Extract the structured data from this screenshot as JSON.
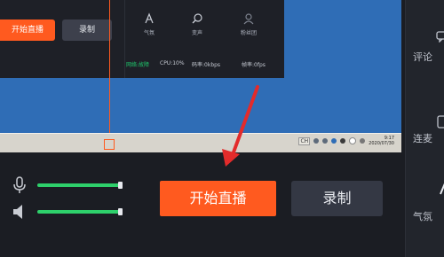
{
  "preview": {
    "mini_panel": {
      "start_label": "开始直播",
      "record_label": "录制",
      "tools": [
        {
          "label": "气氛",
          "icon": "ambience-icon"
        },
        {
          "label": "变声",
          "icon": "voice-changer-icon"
        },
        {
          "label": "粉丝团",
          "icon": "fan-club-icon"
        }
      ],
      "stats": {
        "network": "网络:故障",
        "cpu": "CPU:10%",
        "bitrate": "码率:0kbps",
        "fps": "帧率:0fps"
      }
    },
    "taskbar": {
      "ime_label": "CH",
      "time": "9:17",
      "date": "2020/07/30"
    }
  },
  "sidebar": {
    "items": [
      {
        "label": "评论"
      },
      {
        "label": "连麦"
      },
      {
        "label": "气氛"
      }
    ]
  },
  "controls": {
    "mic_volume": 1.0,
    "speaker_volume": 1.0,
    "start_live_label": "开始直播",
    "record_label": "录制"
  },
  "colors": {
    "accent": "#ff5a1f",
    "volume_fill": "#2ed06b",
    "preview_bg": "#2f6db6",
    "panel_bg": "#1b1d23"
  }
}
